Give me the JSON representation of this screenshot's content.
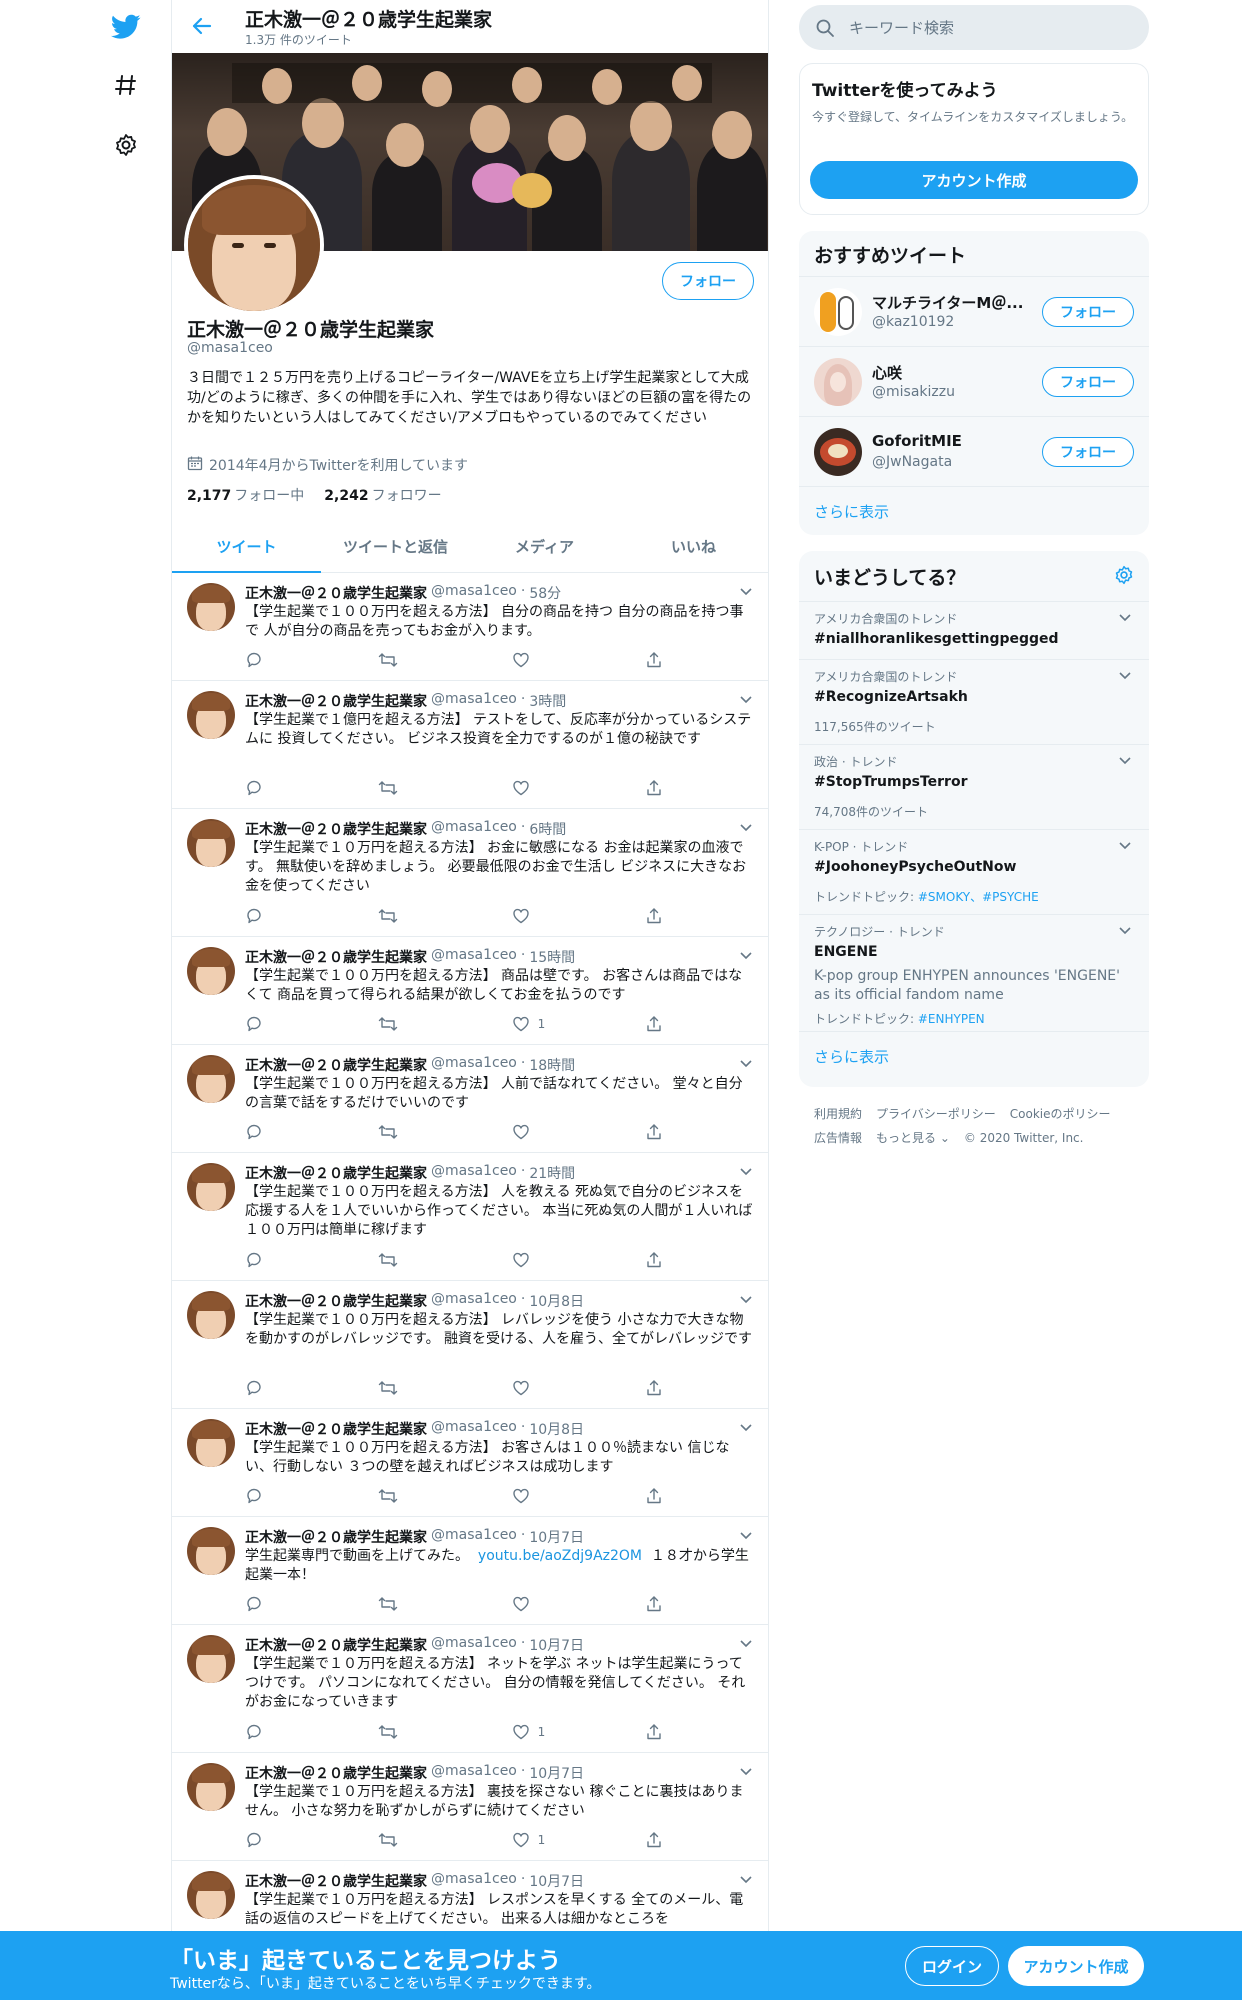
{
  "header": {
    "title": "正木激一＠２０歳学生起業家",
    "subtitle": "1.3万 件のツイート"
  },
  "profile": {
    "name": "正木激一＠２０歳学生起業家",
    "handle": "@masa1ceo",
    "follow_label": "フォロー",
    "bio": "３日間で１２５万円を売り上げるコピーライター/WAVEを立ち上げ学生起業家として大成功/どのように稼ぎ、多くの仲間を手に入れ、学生ではあり得ないほどの巨額の富を得たのかを知りたいという人はしてみてください/アメブロもやっているのでみてください",
    "joined": "2014年4月からTwitterを利用しています",
    "following_count": "2,177",
    "following_label": "フォロー中",
    "followers_count": "2,242",
    "followers_label": "フォロワー"
  },
  "tabs": [
    "ツイート",
    "ツイートと返信",
    "メディア",
    "いいね"
  ],
  "tweets": [
    {
      "name": "正木激一＠２０歳学生起業家",
      "handle": "@masa1ceo",
      "time": "58分",
      "text": "【学生起業で１００万円を超える方法】 自分の商品を持つ 自分の商品を持つ事で 人が自分の商品を売ってもお金が入ります。",
      "likes": ""
    },
    {
      "name": "正木激一＠２０歳学生起業家",
      "handle": "@masa1ceo",
      "time": "3時間",
      "text": "【学生起業で１億円を超える方法】 テストをして、反応率が分かっているシステムに 投資してください。 ビジネス投資を全力でするのが１億の秘訣です",
      "likes": ""
    },
    {
      "name": "正木激一＠２０歳学生起業家",
      "handle": "@masa1ceo",
      "time": "6時間",
      "text": "【学生起業で１０万円を超える方法】 お金に敏感になる お金は起業家の血液です。 無駄使いを辞めましょう。 必要最低限のお金で生活し ビジネスに大きなお金を使ってください",
      "likes": ""
    },
    {
      "name": "正木激一＠２０歳学生起業家",
      "handle": "@masa1ceo",
      "time": "15時間",
      "text": "【学生起業で１００万円を超える方法】 商品は壁です。 お客さんは商品ではなくて 商品を買って得られる結果が欲しくてお金を払うのです",
      "likes": "1"
    },
    {
      "name": "正木激一＠２０歳学生起業家",
      "handle": "@masa1ceo",
      "time": "18時間",
      "text": "【学生起業で１００万円を超える方法】 人前で話なれてください。 堂々と自分の言葉で話をするだけでいいのです",
      "likes": ""
    },
    {
      "name": "正木激一＠２０歳学生起業家",
      "handle": "@masa1ceo",
      "time": "21時間",
      "text": "【学生起業で１００万円を超える方法】 人を教える 死ぬ気で自分のビジネスを応援する人を１人でいいから作ってください。 本当に死ぬ気の人間が１人いれば１００万円は簡単に稼げます",
      "likes": ""
    },
    {
      "name": "正木激一＠２０歳学生起業家",
      "handle": "@masa1ceo",
      "time": "10月8日",
      "text": "【学生起業で１００万円を超える方法】 レバレッジを使う 小さな力で大きな物を動かすのがレバレッジです。 融資を受ける、人を雇う、全てがレバレッジです",
      "likes": ""
    },
    {
      "name": "正木激一＠２０歳学生起業家",
      "handle": "@masa1ceo",
      "time": "10月8日",
      "text": "【学生起業で１００万円を超える方法】 お客さんは１００％読まない 信じない、行動しない ３つの壁を越えればビジネスは成功します",
      "likes": ""
    },
    {
      "name": "正木激一＠２０歳学生起業家",
      "handle": "@masa1ceo",
      "time": "10月7日",
      "text": "学生起業専門で動画を上げてみた。",
      "link": "youtu.be/aoZdj9Az2OM",
      "text2": "１８才から学生起業一本！",
      "likes": ""
    },
    {
      "name": "正木激一＠２０歳学生起業家",
      "handle": "@masa1ceo",
      "time": "10月7日",
      "text": "【学生起業で１０万円を超える方法】 ネットを学ぶ ネットは学生起業にうってつけです。 パソコンになれてください。 自分の情報を発信してください。 それがお金になっていきます",
      "likes": "1"
    },
    {
      "name": "正木激一＠２０歳学生起業家",
      "handle": "@masa1ceo",
      "time": "10月7日",
      "text": "【学生起業で１０万円を超える方法】 裏技を探さない 稼ぐことに裏技はありません。 小さな努力を恥ずかしがらずに続けてください",
      "likes": "1"
    },
    {
      "name": "正木激一＠２０歳学生起業家",
      "handle": "@masa1ceo",
      "time": "10月7日",
      "text": "【学生起業で１０万円を超える方法】 レスポンスを早くする 全てのメール、電話の返信のスピードを上げてください。 出来る人は細かなところを",
      "likes": ""
    }
  ],
  "sidebar": {
    "search_placeholder": "キーワード検索",
    "signup": {
      "title": "Twitterを使ってみよう",
      "desc": "今すぐ登録して、タイムラインをカスタマイズしましょう。",
      "button": "アカウント作成"
    },
    "recommend": {
      "title": "おすすめツイート",
      "users": [
        {
          "name": "マルチライターM＠...",
          "handle": "@kaz10192",
          "button": "フォロー"
        },
        {
          "name": "心咲",
          "handle": "@misakizzu",
          "button": "フォロー"
        },
        {
          "name": "GoforitMIE",
          "handle": "@JwNagata",
          "button": "フォロー"
        }
      ],
      "more": "さらに表示"
    },
    "trends": {
      "title": "いまどうしてる？",
      "items": [
        {
          "context": "アメリカ合衆国のトレンド",
          "title": "#niallhoranlikesgettingpegged",
          "sub": "",
          "topics": ""
        },
        {
          "context": "アメリカ合衆国のトレンド",
          "title": "#RecognizeArtsakh",
          "sub": "117,565件のツイート",
          "topics": ""
        },
        {
          "context": "政治 · トレンド",
          "title": "#StopTrumpsTerror",
          "sub": "74,708件のツイート",
          "topics": ""
        },
        {
          "context": "K-POP · トレンド",
          "title": "#JoohoneyPsycheOutNow",
          "sub": "トレンドトピック:",
          "topics": "#SMOKY、#PSYCHE"
        },
        {
          "context": "テクノロジー · トレンド",
          "title": "ENGENE",
          "desc": "K-pop group ENHYPEN announces 'ENGENE' as its official fandom name",
          "sub": "トレンドトピック:",
          "topics": "#ENHYPEN"
        }
      ],
      "more": "さらに表示"
    },
    "footer": {
      "terms": "利用規約",
      "privacy": "プライバシーポリシー",
      "cookie": "Cookieのポリシー",
      "ads": "広告情報",
      "more": "もっと見る ⌄",
      "copyright": "© 2020 Twitter, Inc."
    }
  },
  "bottom_bar": {
    "title": "「いま」起きていることを見つけよう",
    "subtitle": "Twitterなら、「いま」起きていることをいち早くチェックできます。",
    "login": "ログイン",
    "signup": "アカウント作成"
  },
  "colors": {
    "accent": "#1da1f2",
    "muted": "#657786",
    "border": "#e6ecf0"
  },
  "icons": [
    "twitter-logo-icon",
    "hashtag-icon",
    "settings-gear-icon",
    "back-arrow-icon",
    "search-icon",
    "calendar-icon",
    "reply-icon",
    "retweet-icon",
    "like-icon",
    "share-icon",
    "chevron-down-icon"
  ]
}
